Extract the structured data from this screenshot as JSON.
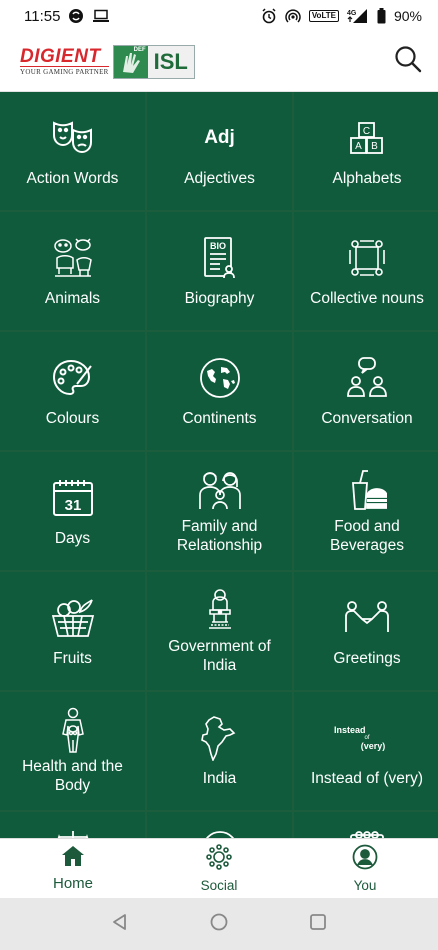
{
  "status_bar": {
    "time": "11:55",
    "network_badge": "VoLTE",
    "signal_label": "4G",
    "battery": "90%"
  },
  "header": {
    "brand_name": "DIGIENT",
    "brand_tagline": "YOUR GAMING PARTNER",
    "logo_badge": "DEF",
    "logo_text": "ISL"
  },
  "categories": [
    {
      "label": "Action Words",
      "icon": "masks-icon"
    },
    {
      "label": "Adjectives",
      "icon": "adj-text-icon",
      "icon_text": "Adj"
    },
    {
      "label": "Alphabets",
      "icon": "abc-blocks-icon",
      "icon_text": [
        "C",
        "A",
        "B"
      ]
    },
    {
      "label": "Animals",
      "icon": "animals-icon"
    },
    {
      "label": "Biography",
      "icon": "bio-document-icon",
      "icon_text": "BIO"
    },
    {
      "label": "Collective nouns",
      "icon": "group-hands-icon"
    },
    {
      "label": "Colours",
      "icon": "palette-icon"
    },
    {
      "label": "Continents",
      "icon": "globe-icon"
    },
    {
      "label": "Conversation",
      "icon": "conversation-icon"
    },
    {
      "label": "Days",
      "icon": "calendar-icon",
      "icon_text": "31"
    },
    {
      "label": "Family and Relationship",
      "icon": "family-icon"
    },
    {
      "label": "Food and Beverages",
      "icon": "food-icon"
    },
    {
      "label": "Fruits",
      "icon": "fruit-basket-icon"
    },
    {
      "label": "Government of India",
      "icon": "emblem-icon"
    },
    {
      "label": "Greetings",
      "icon": "handshake-icon"
    },
    {
      "label": "Health and the Body",
      "icon": "human-body-icon"
    },
    {
      "label": "India",
      "icon": "india-map-icon"
    },
    {
      "label": "Instead of (very)",
      "icon": "instead-text-icon",
      "icon_text": [
        "Instead",
        "of",
        "(very)"
      ]
    },
    {
      "label": "",
      "icon": "scale-icon"
    },
    {
      "label": "",
      "icon": "circle-icon"
    },
    {
      "label": "",
      "icon": "binder-icon"
    }
  ],
  "bottom_nav": [
    {
      "label": "Home",
      "icon": "home-icon",
      "active": true
    },
    {
      "label": "Social",
      "icon": "social-icon",
      "active": false
    },
    {
      "label": "You",
      "icon": "profile-icon",
      "active": false
    }
  ],
  "colors": {
    "tile_bg": "#0f5b3b",
    "grid_line": "#1b5d3d",
    "nav_accent": "#1d5a3c",
    "brand_red": "#d8282e"
  }
}
